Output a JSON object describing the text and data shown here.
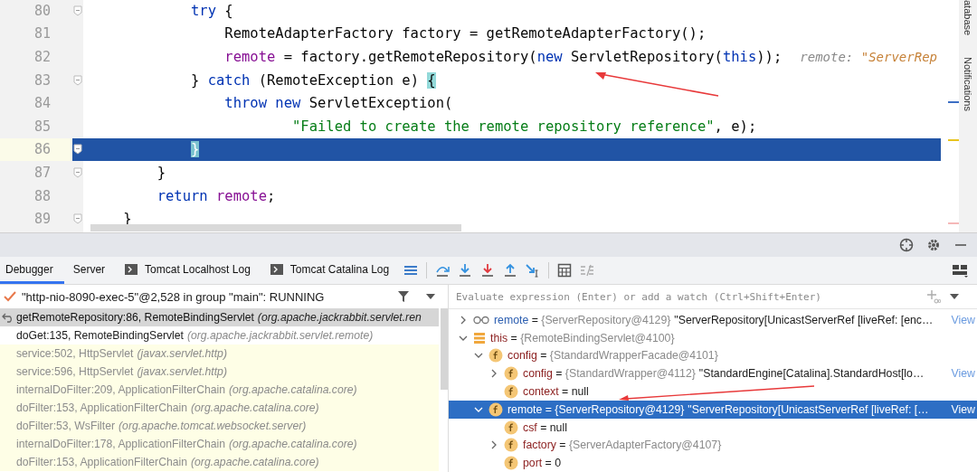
{
  "editor": {
    "lines": [
      {
        "number": "80",
        "fold": true,
        "current": false,
        "tokens": [
          {
            "text": "            try",
            "kind": "keyword"
          },
          {
            "text": " {",
            "kind": "plain"
          }
        ]
      },
      {
        "number": "81",
        "fold": false,
        "current": false,
        "tokens": [
          {
            "text": "                RemoteAdapterFactory factory = getRemoteAdapterFactory();",
            "kind": "plain"
          }
        ]
      },
      {
        "number": "82",
        "fold": false,
        "current": false,
        "tokens": [
          {
            "text": "                remote",
            "kind": "field"
          },
          {
            "text": " = factory.getRemoteRepository(",
            "kind": "plain"
          },
          {
            "text": "new",
            "kind": "keyword"
          },
          {
            "text": " ServletRepository(",
            "kind": "plain"
          },
          {
            "text": "this",
            "kind": "keyword"
          },
          {
            "text": "));",
            "kind": "plain"
          }
        ],
        "hint": {
          "name": "remote: ",
          "value": "\"ServerRep"
        }
      },
      {
        "number": "83",
        "fold": true,
        "current": false,
        "tokens": [
          {
            "text": "            } ",
            "kind": "plain"
          },
          {
            "text": "catch",
            "kind": "keyword"
          },
          {
            "text": " (RemoteException e) ",
            "kind": "plain"
          },
          {
            "text": "{",
            "kind": "brace_match"
          }
        ]
      },
      {
        "number": "84",
        "fold": false,
        "current": false,
        "tokens": [
          {
            "text": "                throw new",
            "kind": "keyword"
          },
          {
            "text": " ServletException(",
            "kind": "plain"
          }
        ]
      },
      {
        "number": "85",
        "fold": false,
        "current": false,
        "tokens": [
          {
            "text": "                        \"Failed to create the remote repository reference\"",
            "kind": "string"
          },
          {
            "text": ", e);",
            "kind": "plain"
          }
        ]
      },
      {
        "number": "86",
        "fold": true,
        "current": true,
        "tokens": [
          {
            "text": "            }",
            "kind": "brace_match"
          }
        ]
      },
      {
        "number": "87",
        "fold": true,
        "current": false,
        "tokens": [
          {
            "text": "        }",
            "kind": "plain"
          }
        ]
      },
      {
        "number": "88",
        "fold": false,
        "current": false,
        "tokens": [
          {
            "text": "        return",
            "kind": "keyword"
          },
          {
            "text": " remote",
            "kind": "field"
          },
          {
            "text": ";",
            "kind": "plain"
          }
        ]
      },
      {
        "number": "89",
        "fold": true,
        "current": false,
        "tokens": [
          {
            "text": "    }",
            "kind": "plain"
          }
        ]
      }
    ]
  },
  "side_tabs": [
    "atabase",
    "Notifications"
  ],
  "tabs": [
    {
      "label": "Debugger",
      "selected": true,
      "kind": "plain"
    },
    {
      "label": "Server",
      "selected": false,
      "kind": "plain"
    },
    {
      "label": "Tomcat Localhost Log",
      "selected": false,
      "kind": "console"
    },
    {
      "label": "Tomcat Catalina Log",
      "selected": false,
      "kind": "console"
    }
  ],
  "thread": {
    "text": "\"http-nio-8090-exec-5\"@2,528 in group \"main\": RUNNING"
  },
  "frames": [
    {
      "location": "getRemoteRepository:86, RemoteBindingServlet",
      "package": "(org.apache.jackrabbit.servlet.ren",
      "selected": true,
      "library": false
    },
    {
      "location": "doGet:135, RemoteBindingServlet",
      "package": "(org.apache.jackrabbit.servlet.remote)",
      "selected": false,
      "library": false
    },
    {
      "location": "service:502, HttpServlet",
      "package": "(javax.servlet.http)",
      "selected": false,
      "library": true
    },
    {
      "location": "service:596, HttpServlet",
      "package": "(javax.servlet.http)",
      "selected": false,
      "library": true
    },
    {
      "location": "internalDoFilter:209, ApplicationFilterChain",
      "package": "(org.apache.catalina.core)",
      "selected": false,
      "library": true
    },
    {
      "location": "doFilter:153, ApplicationFilterChain",
      "package": "(org.apache.catalina.core)",
      "selected": false,
      "library": true
    },
    {
      "location": "doFilter:53, WsFilter",
      "package": "(org.apache.tomcat.websocket.server)",
      "selected": false,
      "library": true
    },
    {
      "location": "internalDoFilter:178, ApplicationFilterChain",
      "package": "(org.apache.catalina.core)",
      "selected": false,
      "library": true
    },
    {
      "location": "doFilter:153, ApplicationFilterChain",
      "package": "(org.apache.catalina.core)",
      "selected": false,
      "library": true
    }
  ],
  "evaluate": {
    "placeholder": "Evaluate expression (Enter) or add a watch (Ctrl+Shift+Enter)"
  },
  "variables": [
    {
      "kind": "watch",
      "name": "remote",
      "separator": "=",
      "value": "{ServerRepository@4129}",
      "string": "\"ServerRepository[UnicastServerRef [liveRef: [enc…",
      "link": "View",
      "expandable": true,
      "expanded": false,
      "selected": false
    },
    {
      "kind": "object",
      "name": "this",
      "separator": "=",
      "value": "{RemoteBindingServlet@4100}",
      "expandable": true,
      "expanded": true,
      "selected": false,
      "children": [
        {
          "kind": "field",
          "name": "config",
          "separator": "=",
          "value": "{StandardWrapperFacade@4101}",
          "expandable": true,
          "expanded": true,
          "selected": false,
          "children": [
            {
              "kind": "field",
              "name": "config",
              "separator": "=",
              "value": "{StandardWrapper@4112}",
              "string": "\"StandardEngine[Catalina].StandardHost[lo…",
              "link": "View",
              "expandable": true,
              "expanded": false,
              "selected": false
            },
            {
              "kind": "field",
              "name": "context",
              "separator": "=",
              "value": "null",
              "expandable": false,
              "expanded": false,
              "selected": false
            }
          ]
        },
        {
          "kind": "field",
          "name": "remote",
          "separator": "=",
          "value": "{ServerRepository@4129}",
          "string": "\"ServerRepository[UnicastServerRef [liveRef: […",
          "link": "View",
          "expandable": true,
          "expanded": true,
          "selected": true,
          "children": [
            {
              "kind": "field",
              "name": "csf",
              "separator": "=",
              "value": "null",
              "expandable": false,
              "expanded": false,
              "selected": false
            },
            {
              "kind": "field",
              "name": "factory",
              "separator": "=",
              "value": "{ServerAdapterFactory@4107}",
              "expandable": true,
              "expanded": false,
              "selected": false
            },
            {
              "kind": "field",
              "name": "port",
              "separator": "=",
              "value": "0",
              "expandable": false,
              "expanded": false,
              "selected": false
            }
          ]
        }
      ]
    }
  ]
}
